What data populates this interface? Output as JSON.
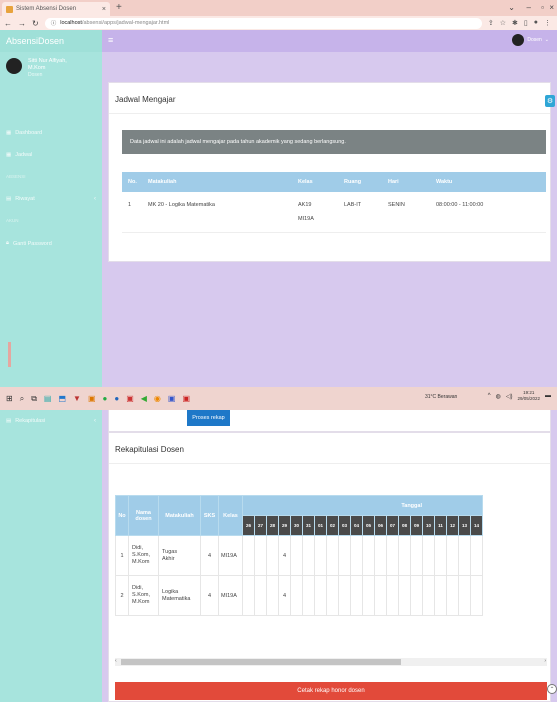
{
  "browser": {
    "tab_title": "Sistem Absensi Dosen",
    "url_host": "localhost",
    "url_path": "/absensi/apps/jadwal-mengajar.html"
  },
  "header": {
    "brand": "AbsensiDosen",
    "user_label": "Dosen"
  },
  "sidebar": {
    "profile_name_line1": "Sitti Nur Alfiyah,",
    "profile_name_line2": "M.Kom",
    "profile_status": "Dosen",
    "items": [
      {
        "label": "Dashboard"
      },
      {
        "label": "Jadwal"
      },
      {
        "label": "Riwayat"
      },
      {
        "label": "Ganti Password"
      },
      {
        "label": "Rekapitulasi"
      }
    ],
    "headers": [
      "ABSENSI",
      "AKUN"
    ]
  },
  "jadwal": {
    "title": "Jadwal Mengajar",
    "info": "Data jadwal ini adalah jadwal mengajar pada tahun akademik yang sedang berlangsung.",
    "columns": [
      "No.",
      "Matakuliah",
      "Kelas",
      "Ruang",
      "Hari",
      "Waktu"
    ],
    "row": {
      "no": "1",
      "matakuliah": "MK 20 - Logika Matematika",
      "kelas1": "AK19",
      "kelas2": "MI19A",
      "ruang": "LAB-IT",
      "hari": "SENIN",
      "waktu": "08:00:00 - 11:00:00"
    }
  },
  "taskbar": {
    "weather": "31°C  Berawan",
    "time": "19:21",
    "date": "29/05/2022"
  },
  "rekap": {
    "proses_label": "Proses rekap",
    "title": "Rekapitulasi Dosen",
    "columns": [
      "No",
      "Nama dosen",
      "Matakuliah",
      "SKS",
      "Kelas"
    ],
    "tanggal_label": "Tanggal",
    "days": [
      "26",
      "27",
      "28",
      "29",
      "30",
      "31",
      "01",
      "02",
      "03",
      "04",
      "05",
      "06",
      "07",
      "08",
      "09",
      "10",
      "11",
      "12",
      "13",
      "14"
    ],
    "rows": [
      {
        "no": "1",
        "nama1": "Didi,",
        "nama2": "S.Kom,",
        "nama3": "M.Kom",
        "mk1": "Tugas",
        "mk2": "Akhir",
        "sks": "4",
        "kelas": "MI19A",
        "val": "4"
      },
      {
        "no": "2",
        "nama1": "Didi,",
        "nama2": "S.Kom,",
        "nama3": "M.Kom",
        "mk1": "Logika",
        "mk2": "Matematika",
        "sks": "4",
        "kelas": "MI19A",
        "val": "4"
      }
    ],
    "cetak_label": "Cetak rekap honor dosen"
  }
}
